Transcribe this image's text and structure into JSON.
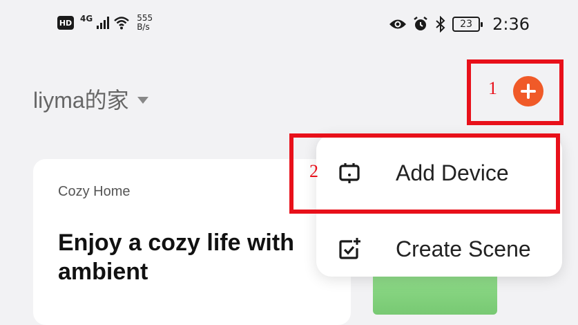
{
  "status_bar": {
    "hd_label": "HD",
    "network_label": "4G",
    "speed_value": "555",
    "speed_unit": "B/s",
    "battery_level": "23",
    "time": "2:36",
    "icons": [
      "eye-icon",
      "alarm-icon",
      "bluetooth-icon"
    ]
  },
  "header": {
    "home_name": "liyma的家"
  },
  "card": {
    "subtitle": "Cozy Home",
    "headline": "Enjoy a cozy life with ambient"
  },
  "menu": {
    "items": [
      {
        "label": "Add Device",
        "icon": "device-icon"
      },
      {
        "label": "Create Scene",
        "icon": "scene-icon"
      }
    ]
  },
  "annotations": {
    "marker_1": "1",
    "marker_2": "2",
    "color": "#e8101a"
  },
  "colors": {
    "accent": "#f05a28",
    "background": "#f2f2f4"
  }
}
